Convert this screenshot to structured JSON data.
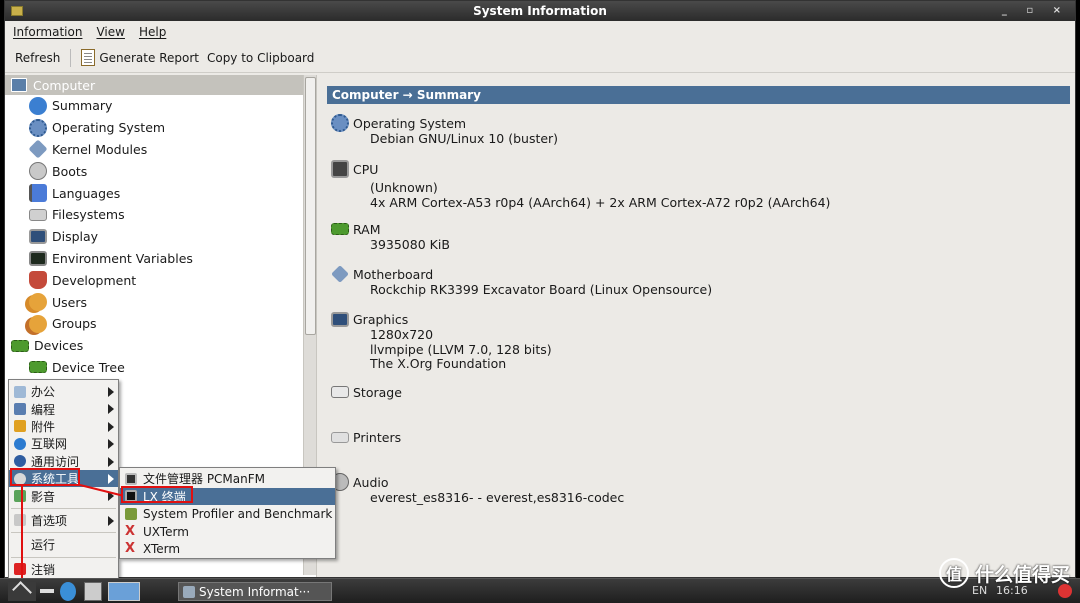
{
  "window": {
    "title": "System Information",
    "controls": "_ ▫ ×"
  },
  "menubar": {
    "items": [
      "Information",
      "View",
      "Help"
    ]
  },
  "toolbar": {
    "refresh": "Refresh",
    "generate_report": "Generate Report",
    "copy_clipboard": "Copy to Clipboard"
  },
  "tree": {
    "header": "Computer",
    "computer_items": [
      "Summary",
      "Operating System",
      "Kernel Modules",
      "Boots",
      "Languages",
      "Filesystems",
      "Display",
      "Environment Variables",
      "Development",
      "Users",
      "Groups"
    ],
    "devices_label": "Devices",
    "devices_items": [
      "Device Tree"
    ]
  },
  "summary": {
    "header": "Computer → Summary",
    "sections": [
      {
        "title": "Operating System",
        "values": [
          "Debian GNU/Linux 10 (buster)"
        ]
      },
      {
        "title": "CPU",
        "values": [
          "(Unknown)",
          "4x ARM Cortex-A53 r0p4 (AArch64) + 2x ARM Cortex-A72 r0p2 (AArch64)"
        ]
      },
      {
        "title": "RAM",
        "values": [
          "3935080 KiB"
        ]
      },
      {
        "title": "Motherboard",
        "values": [
          "Rockchip RK3399 Excavator Board (Linux Opensource)"
        ]
      },
      {
        "title": "Graphics",
        "values": [
          "1280x720",
          "llvmpipe (LLVM 7.0, 128 bits)",
          "The X.Org Foundation"
        ]
      },
      {
        "title": "Storage",
        "values": []
      },
      {
        "title": "Printers",
        "values": []
      },
      {
        "title": "Audio",
        "values": [
          "everest_es8316- - everest,es8316-codec"
        ]
      }
    ]
  },
  "start_menu": {
    "items": [
      "办公",
      "编程",
      "附件",
      "互联网",
      "通用访问",
      "系统工具",
      "影音",
      "首选项",
      "运行",
      "注销"
    ]
  },
  "submenu": {
    "items": [
      "文件管理器 PCManFM",
      "LX 终端",
      "System Profiler and Benchmark",
      "UXTerm",
      "XTerm"
    ]
  },
  "taskbar": {
    "task_label": "System Informat···",
    "lang": "EN",
    "clock": "16:16"
  },
  "watermark": {
    "logo": "值",
    "text": "什么值得买"
  },
  "colors": {
    "accent": "#4a6f96",
    "highlight_box": "#e01010"
  }
}
